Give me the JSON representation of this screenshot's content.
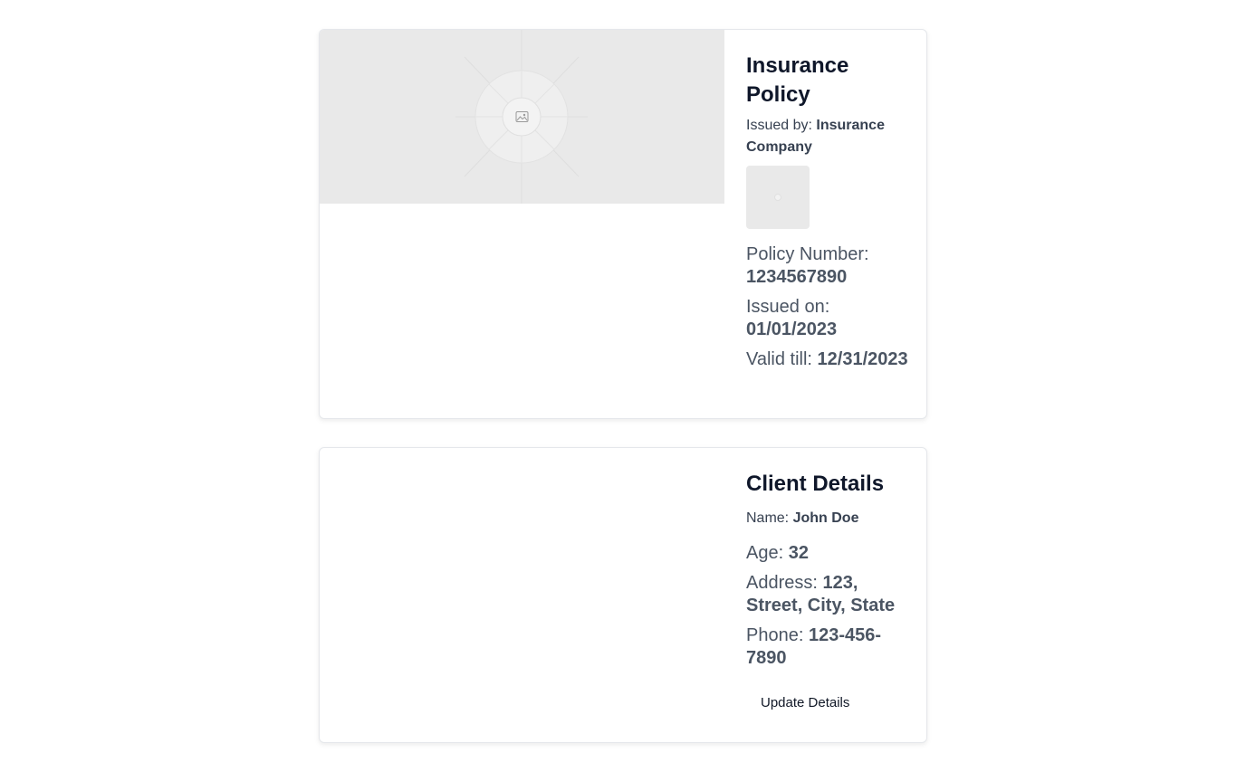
{
  "policy": {
    "title": "Insurance Policy",
    "issued_by_label": "Issued by: ",
    "issuer": "Insurance Company",
    "image_icon": "image-placeholder-icon",
    "fields": [
      {
        "label": "Policy Number: ",
        "value": "1234567890"
      },
      {
        "label": "Issued on: ",
        "value": "01/01/2023"
      },
      {
        "label": "Valid till: ",
        "value": "12/31/2023"
      }
    ]
  },
  "client": {
    "title": "Client Details",
    "name_label": "Name: ",
    "name": "John Doe",
    "fields": [
      {
        "label": "Age: ",
        "value": "32"
      },
      {
        "label": "Address: ",
        "value": "123, Street, City, State"
      },
      {
        "label": "Phone: ",
        "value": "123-456-7890"
      }
    ],
    "update_button": "Update Details"
  },
  "colors": {
    "title": "#0f172a",
    "text": "#374151",
    "field_text": "#4b5563",
    "placeholder_bg": "#e9e9e9",
    "border": "#e5e7eb"
  }
}
